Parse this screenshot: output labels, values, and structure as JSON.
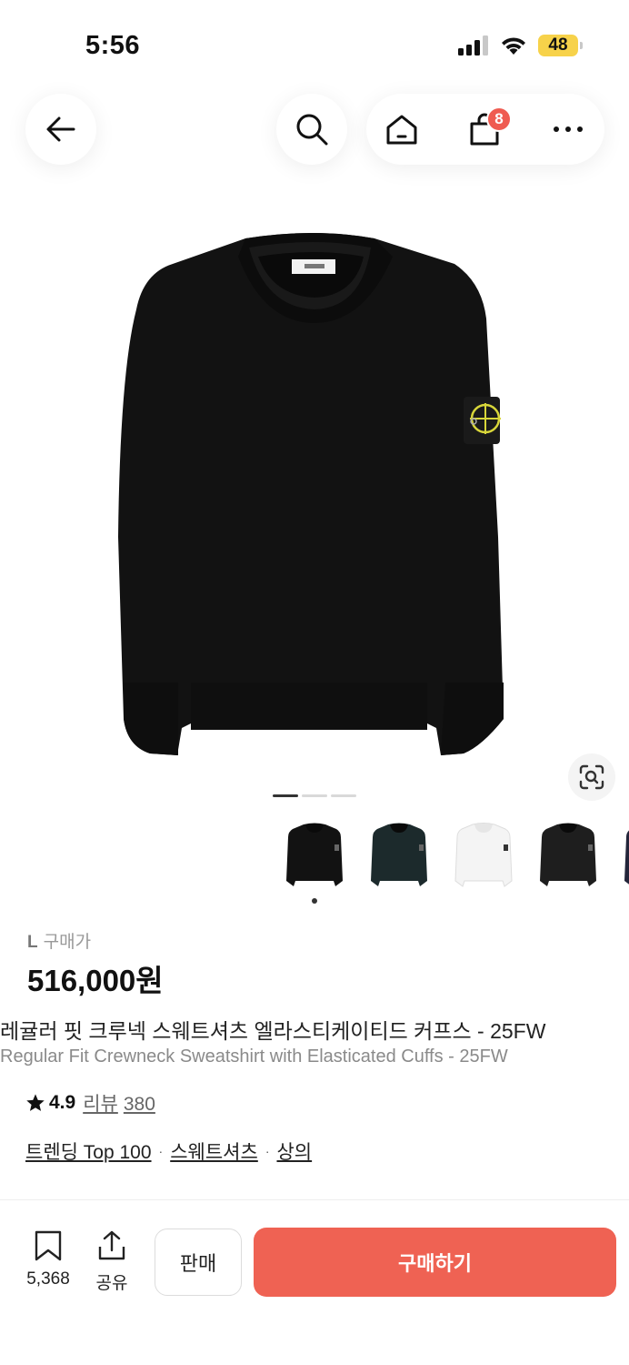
{
  "status_bar": {
    "time": "5:56",
    "battery": "48"
  },
  "nav": {
    "back_icon": "arrow-left-icon",
    "search_icon": "search-icon",
    "home_icon": "home-icon",
    "cart_icon": "shopping-bag-icon",
    "cart_count": "8",
    "more_icon": "more-horizontal-icon"
  },
  "gallery": {
    "image_count": 3,
    "active_index": 0,
    "thumbnail_colors": [
      "#121212",
      "#1c2a2c",
      "#f4f4f4",
      "#1e1e1e",
      "#23253a"
    ]
  },
  "product": {
    "size": "L",
    "price_label": "구매가",
    "price": "516,000원",
    "title_ko": "레귤러 핏 크루넥 스웨트셔츠 엘라스티케이티드 커프스 - 25FW",
    "title_en": "Regular Fit Crewneck Sweatshirt with Elasticated Cuffs  - 25FW",
    "rating": "4.9",
    "review_label": "리뷰",
    "review_count": "380",
    "tags": [
      "트렌딩 Top 100",
      "스웨트셔츠",
      "상의"
    ]
  },
  "bottom_bar": {
    "bookmark_count": "5,368",
    "share_label": "공유",
    "sell_label": "판매",
    "buy_label": "구매하기"
  },
  "colors": {
    "accent": "#ef6253",
    "badge": "#ef5b51",
    "battery": "#f7d24a"
  }
}
